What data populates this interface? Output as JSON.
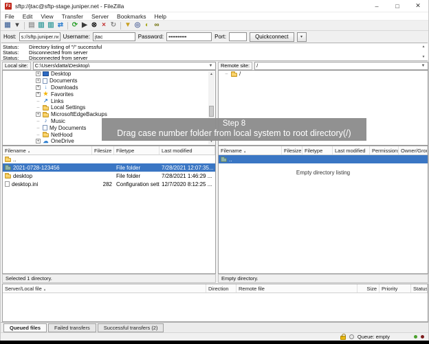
{
  "window": {
    "title": "sftp://jtac@sftp-stage.juniper.net - FileZilla",
    "controls": {
      "minimize": "–",
      "maximize": "□",
      "close": "✕"
    }
  },
  "menu": {
    "items": [
      "File",
      "Edit",
      "View",
      "Transfer",
      "Server",
      "Bookmarks",
      "Help"
    ]
  },
  "toolbar": {
    "icons": [
      {
        "name": "site-manager-icon",
        "glyph": "▦",
        "color": "#5f7ca8"
      },
      {
        "name": "site-manager-dropdown-icon",
        "glyph": "▾",
        "color": "#444444"
      },
      {
        "name": "separator"
      },
      {
        "name": "toggle-log-icon",
        "glyph": "▤",
        "color": "#9a9a9a"
      },
      {
        "name": "toggle-local-tree-icon",
        "glyph": "▥",
        "color": "#3f9f9f"
      },
      {
        "name": "toggle-remote-tree-icon",
        "glyph": "▥",
        "color": "#3f9f9f"
      },
      {
        "name": "toggle-queue-icon",
        "glyph": "⇄",
        "color": "#2f7fd0"
      },
      {
        "name": "separator"
      },
      {
        "name": "refresh-icon",
        "glyph": "⟳",
        "color": "#2ca02c"
      },
      {
        "name": "process-queue-icon",
        "glyph": "▶",
        "color": "#3a3a3a"
      },
      {
        "name": "cancel-icon",
        "glyph": "⊗",
        "color": "#1a1a1a"
      },
      {
        "name": "disconnect-icon",
        "glyph": "×",
        "color": "#c23030"
      },
      {
        "name": "reconnect-icon",
        "glyph": "↻",
        "color": "#8a8a8a"
      },
      {
        "name": "separator"
      },
      {
        "name": "filter-icon",
        "glyph": "▼",
        "color": "#c8a020"
      },
      {
        "name": "compare-icon",
        "glyph": "◎",
        "color": "#566a9e"
      },
      {
        "name": "sync-browse-icon",
        "glyph": "◐",
        "color": "#a9a920"
      },
      {
        "name": "find-icon",
        "glyph": "∞",
        "color": "#6b6b00"
      }
    ]
  },
  "quickconnect": {
    "host_label": "Host:",
    "host_value": "s://sftp.juniper.net",
    "username_label": "Username:",
    "username_value": "jtac",
    "password_label": "Password:",
    "password_value": "••••••••••",
    "port_label": "Port:",
    "port_value": "",
    "button_label": "Quickconnect"
  },
  "status_log": {
    "lines": [
      {
        "label": "Status:",
        "text": "Directory listing of \"/\" successful"
      },
      {
        "label": "Status:",
        "text": "Disconnected from server"
      },
      {
        "label": "Status:",
        "text": "Disconnected from server"
      }
    ]
  },
  "local_pane": {
    "label": "Local site:",
    "path": "C:\\Users\\datta\\Desktop\\",
    "tree": [
      {
        "label": "Desktop",
        "icon": "desktop-icon",
        "expand": true
      },
      {
        "label": "Documents",
        "icon": "documents-icon",
        "expand": true
      },
      {
        "label": "Downloads",
        "icon": "downloads-icon",
        "expand": true
      },
      {
        "label": "Favorites",
        "icon": "favorites-icon",
        "expand": true
      },
      {
        "label": "Links",
        "icon": "links-icon",
        "expand": false
      },
      {
        "label": "Local Settings",
        "icon": "folder-icon",
        "expand": false
      },
      {
        "label": "MicrosoftEdgeBackups",
        "icon": "folder-icon",
        "expand": true
      },
      {
        "label": "Music",
        "icon": "music-icon",
        "expand": false
      },
      {
        "label": "My Documents",
        "icon": "documents-icon",
        "expand": false
      },
      {
        "label": "NetHood",
        "icon": "folder-icon",
        "expand": false
      },
      {
        "label": "OneDrive",
        "icon": "onedrive-icon",
        "expand": true
      }
    ]
  },
  "remote_pane": {
    "label": "Remote site:",
    "path": "/",
    "tree": [
      {
        "label": "/",
        "icon": "folder-icon",
        "expand": false
      }
    ]
  },
  "local_files": {
    "headers": [
      "Filename",
      "Filesize",
      "Filetype",
      "Last modified"
    ],
    "rows": [
      {
        "name": "..",
        "icon": "folder-icon",
        "size": "",
        "type": "",
        "modified": "",
        "selected": false
      },
      {
        "name": "2021-0728-123456",
        "icon": "folder-icon",
        "size": "",
        "type": "File folder",
        "modified": "7/28/2021 12:07:35...",
        "selected": true
      },
      {
        "name": "desktop",
        "icon": "folder-icon",
        "size": "",
        "type": "File folder",
        "modified": "7/28/2021 1:46:29 ...",
        "selected": false
      },
      {
        "name": "desktop.ini",
        "icon": "file-icon",
        "size": "282",
        "type": "Configuration setti...",
        "modified": "12/7/2020 8:12:25 ...",
        "selected": false
      }
    ],
    "status": "Selected 1 directory."
  },
  "remote_files": {
    "headers": [
      "Filename",
      "Filesize",
      "Filetype",
      "Last modified",
      "Permissions",
      "Owner/Group"
    ],
    "rows": [
      {
        "name": "..",
        "icon": "folder-icon",
        "size": "",
        "type": "",
        "modified": "",
        "permissions": "",
        "owner": "",
        "selected": true
      }
    ],
    "empty_text": "Empty directory listing",
    "status": "Empty directory."
  },
  "queue": {
    "headers": [
      "Server/Local file",
      "Direction",
      "Remote file",
      "Size",
      "Priority",
      "Status"
    ]
  },
  "tabs": {
    "items": [
      {
        "label": "Queued files",
        "active": true
      },
      {
        "label": "Failed transfers",
        "active": false
      },
      {
        "label": "Successful transfers (2)",
        "active": false
      }
    ]
  },
  "statusbar": {
    "queue_text": "Queue: empty",
    "leds": [
      "#4aa02c",
      "#7e1e1e"
    ]
  },
  "overlay": {
    "step": "Step 8",
    "text": "Drag case number folder from local system to root directory(/)"
  },
  "colors": {
    "selection": "#3a76c4",
    "overlay_bg": "#8d8d8d",
    "folder": "#f0c24b"
  }
}
